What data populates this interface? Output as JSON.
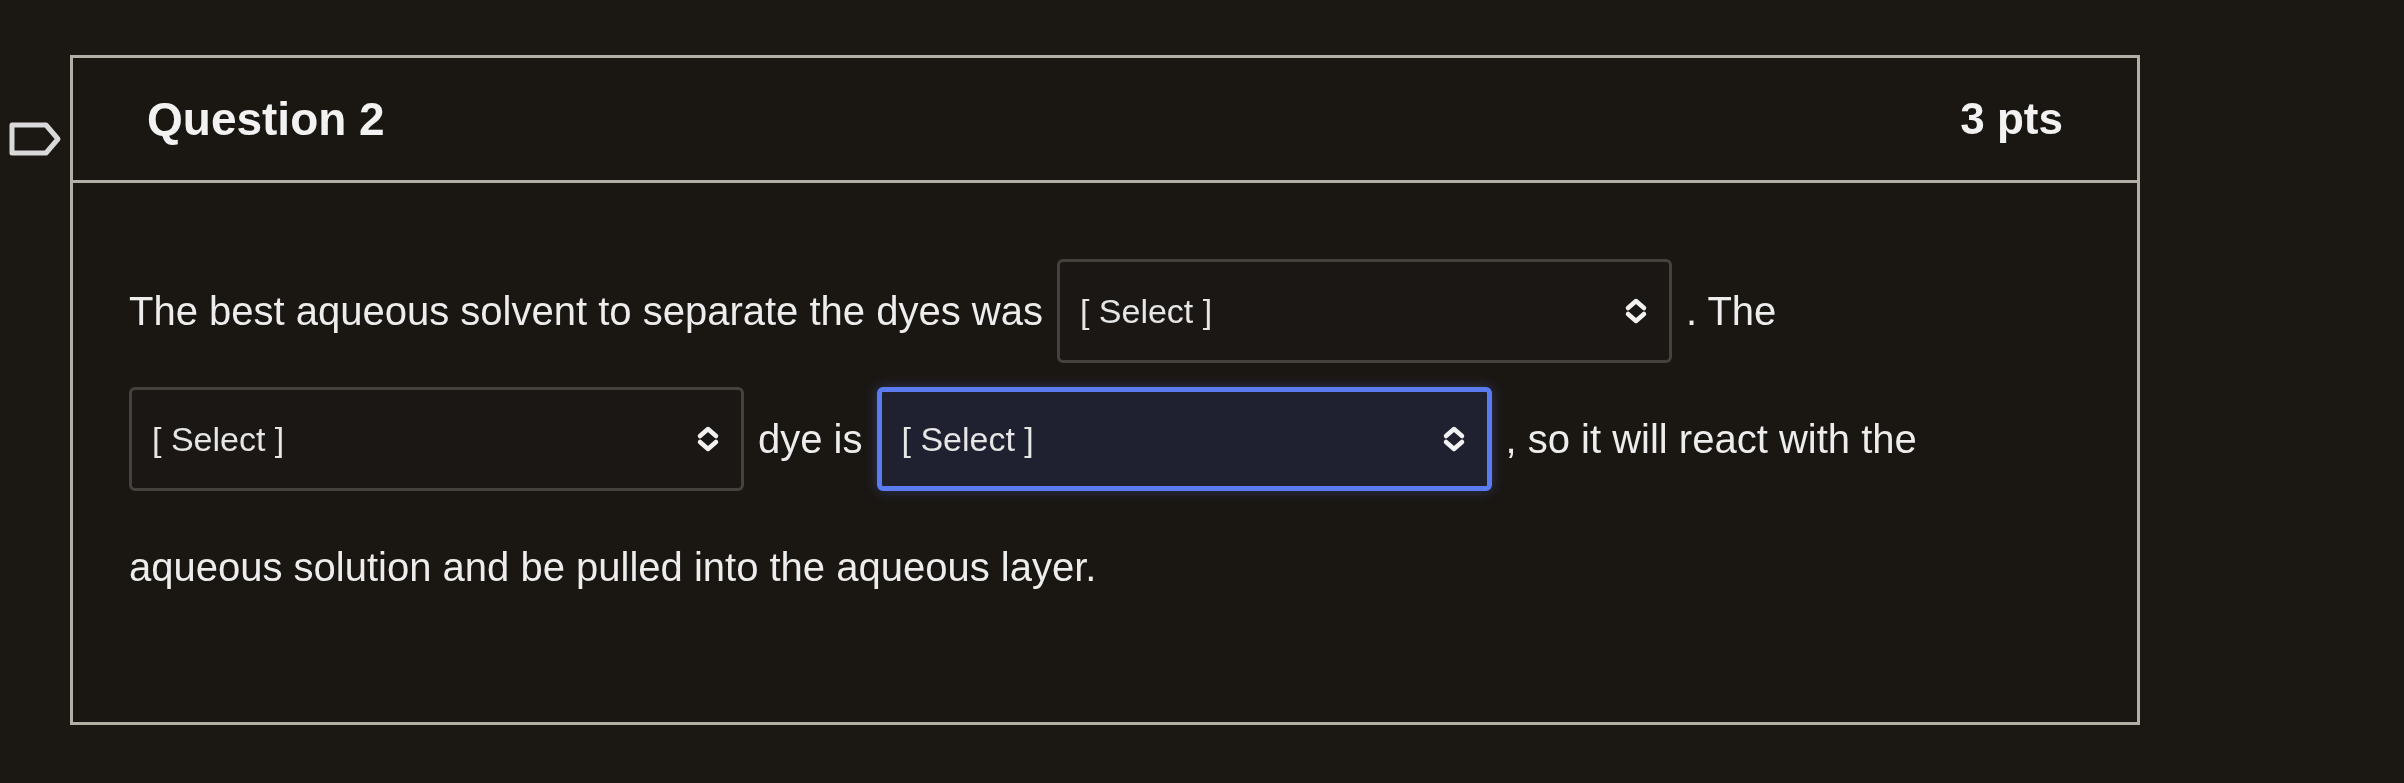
{
  "question": {
    "title": "Question 2",
    "points": "3 pts",
    "lines": [
      {
        "segments": [
          {
            "kind": "text",
            "text": "The best aqueous solvent to separate the dyes was"
          },
          {
            "kind": "select",
            "value": "[ Select ]",
            "focused": false
          },
          {
            "kind": "text",
            "text": ". The"
          }
        ]
      },
      {
        "segments": [
          {
            "kind": "select",
            "value": "[ Select ]",
            "focused": false
          },
          {
            "kind": "text",
            "text": "dye is"
          },
          {
            "kind": "select",
            "value": "[ Select ]",
            "focused": true
          },
          {
            "kind": "text",
            "text": ", so it will react with the"
          }
        ]
      },
      {
        "segments": [
          {
            "kind": "text",
            "text": "aqueous solution and be pulled into the aqueous layer."
          }
        ]
      }
    ]
  }
}
